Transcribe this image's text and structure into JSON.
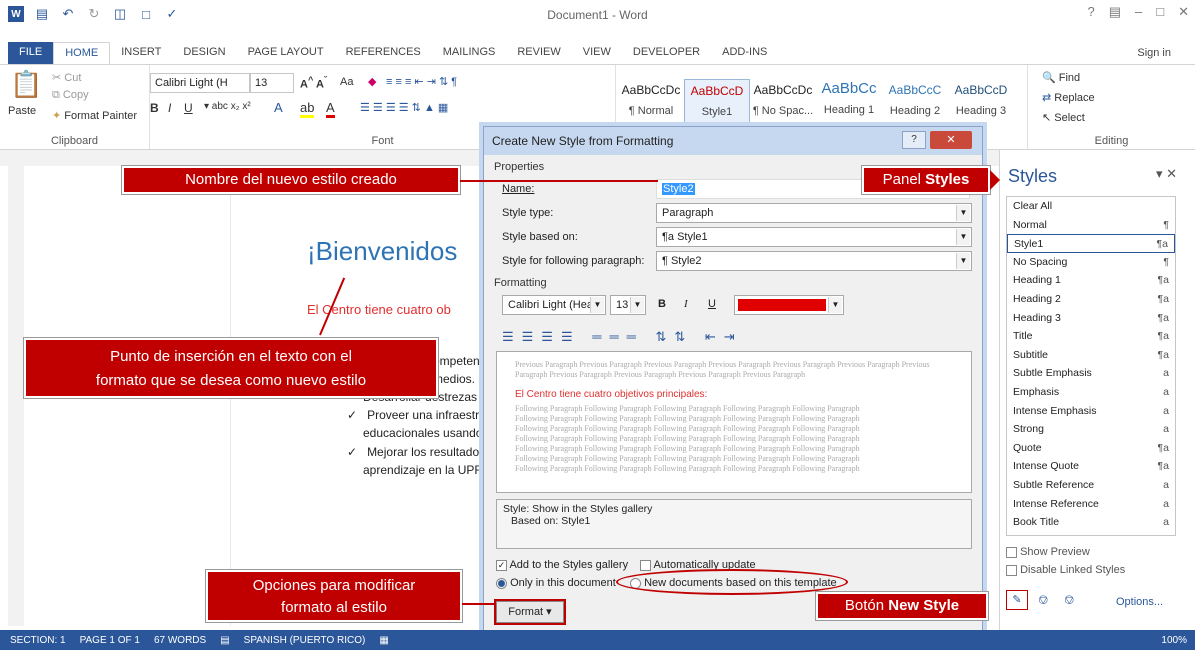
{
  "window": {
    "title": "Document1 - Word",
    "help": "?",
    "sign_in": "Sign in"
  },
  "tabs": [
    "FILE",
    "HOME",
    "INSERT",
    "DESIGN",
    "PAGE LAYOUT",
    "REFERENCES",
    "MAILINGS",
    "REVIEW",
    "VIEW",
    "DEVELOPER",
    "ADD-INS"
  ],
  "ribbon": {
    "clipboard": {
      "label": "Clipboard",
      "paste": "Paste",
      "cut": "Cut",
      "copy": "Copy",
      "format_painter": "Format Painter"
    },
    "font": {
      "label": "Font",
      "family": "Calibri Light (H",
      "size": "13",
      "case": "Aa"
    },
    "styles": [
      {
        "preview": "AaBbCcDc",
        "name": "¶ Normal"
      },
      {
        "preview": "AaBbCcD",
        "name": "Style1"
      },
      {
        "preview": "AaBbCcDc",
        "name": "¶ No Spac..."
      },
      {
        "preview": "AaBbCc",
        "name": "Heading 1"
      },
      {
        "preview": "AaBbCcC",
        "name": "Heading 2"
      },
      {
        "preview": "AaBbCcD",
        "name": "Heading 3"
      }
    ],
    "editing": {
      "label": "Editing",
      "find": "Find",
      "replace": "Replace",
      "select": "Select"
    }
  },
  "document": {
    "heading": "¡Bienvenidos",
    "red_line_1": "El Centro",
    "red_line_2": " tiene cuatro ob",
    "lines": [
      "competen",
      "timedios.",
      "Desarrollar destrezas",
      "Proveer una infraestr",
      "educacionales usando",
      "Mejorar los resultado",
      "aprendizaje en la UPR"
    ]
  },
  "dialog": {
    "title": "Create New Style from Formatting",
    "properties_label": "Properties",
    "name_label": "Name:",
    "name_value": "Style2",
    "type_label": "Style type:",
    "type_value": "Paragraph",
    "based_label": "Style based on:",
    "based_value": "¶a Style1",
    "following_label": "Style for following paragraph:",
    "following_value": "¶ Style2",
    "formatting_label": "Formatting",
    "font_value": "Calibri Light (Head",
    "size_value": "13",
    "preview_previous": "Previous Paragraph Previous Paragraph Previous Paragraph Previous Paragraph Previous Paragraph Previous Paragraph Previous Paragraph Previous Paragraph Previous Paragraph Previous Paragraph Previous Paragraph",
    "preview_sample": "El Centro tiene cuatro objetivos principales:",
    "preview_following": "Following Paragraph Following Paragraph Following Paragraph Following Paragraph Following Paragraph",
    "description_line1": "Style: Show in the Styles gallery",
    "description_line2": "Based on: Style1",
    "add_gallery": "Add to the Styles gallery",
    "auto_update": "Automatically update",
    "only_doc": "Only in this document",
    "new_docs": "New documents based on this template",
    "format_btn": "Format ▾"
  },
  "styles_pane": {
    "title": "Styles",
    "items": [
      {
        "name": "Clear All",
        "mark": ""
      },
      {
        "name": "Normal",
        "mark": "¶"
      },
      {
        "name": "Style1",
        "mark": "¶a"
      },
      {
        "name": "No Spacing",
        "mark": "¶"
      },
      {
        "name": "Heading 1",
        "mark": "¶a"
      },
      {
        "name": "Heading 2",
        "mark": "¶a"
      },
      {
        "name": "Heading 3",
        "mark": "¶a"
      },
      {
        "name": "Title",
        "mark": "¶a"
      },
      {
        "name": "Subtitle",
        "mark": "¶a"
      },
      {
        "name": "Subtle Emphasis",
        "mark": "a"
      },
      {
        "name": "Emphasis",
        "mark": "a"
      },
      {
        "name": "Intense Emphasis",
        "mark": "a"
      },
      {
        "name": "Strong",
        "mark": "a"
      },
      {
        "name": "Quote",
        "mark": "¶a"
      },
      {
        "name": "Intense Quote",
        "mark": "¶a"
      },
      {
        "name": "Subtle Reference",
        "mark": "a"
      },
      {
        "name": "Intense Reference",
        "mark": "a"
      },
      {
        "name": "Book Title",
        "mark": "a"
      }
    ],
    "show_preview": "Show Preview",
    "disable_linked": "Disable Linked Styles",
    "options": "Options..."
  },
  "callouts": {
    "name": "Nombre del nuevo estilo creado",
    "panel_prefix": "Panel ",
    "panel_bold": "Styles",
    "insertion_1": "Punto de inserción en el texto con el",
    "insertion_2": "formato que se desea como nuevo estilo",
    "options_1": "Opciones para modificar",
    "options_2": "formato al estilo",
    "newstyle_prefix": "Botón ",
    "newstyle_bold": "New Style"
  },
  "status": {
    "section": "SECTION: 1",
    "page": "PAGE 1 OF 1",
    "words": "67 WORDS",
    "language": "SPANISH (PUERTO RICO)",
    "zoom": "100%"
  },
  "colors": {
    "accent": "#2b579a",
    "callout": "#c00000",
    "font_color": "#e00000"
  }
}
